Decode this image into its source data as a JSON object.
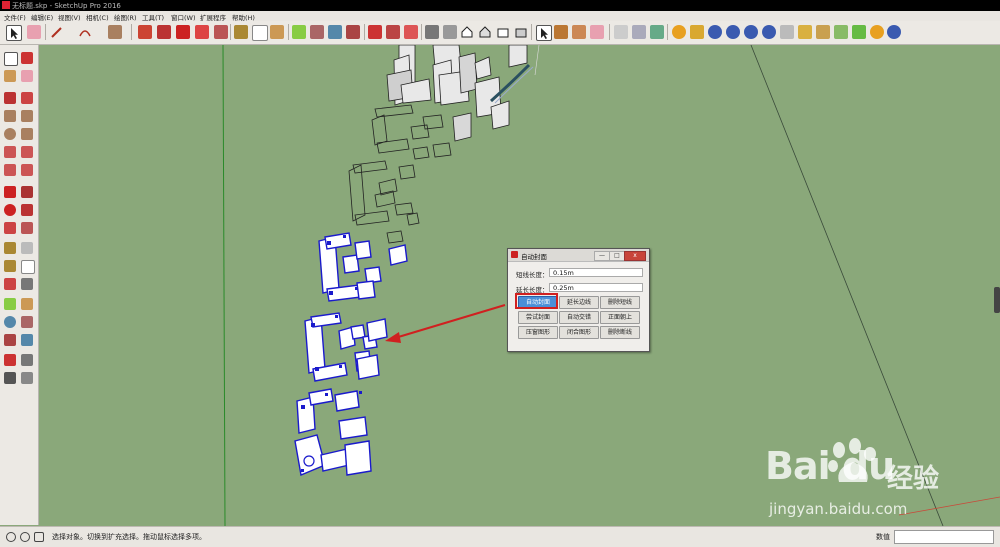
{
  "window": {
    "title": "无标题.skp - SketchUp Pro 2016"
  },
  "menu": {
    "items": [
      "文件(F)",
      "编辑(E)",
      "视图(V)",
      "相机(C)",
      "绘图(R)",
      "工具(T)",
      "窗口(W)",
      "扩展程序",
      "帮助(H)"
    ]
  },
  "dialog": {
    "title": "自动封面",
    "fields": [
      {
        "label": "短线长度：",
        "value": "0.15m"
      },
      {
        "label": "延长长度：",
        "value": "0.25m"
      }
    ],
    "buttons": [
      [
        "自动封面",
        "延长边线",
        "删除短线"
      ],
      [
        "尝试封面",
        "自动交错",
        "正面朝上"
      ],
      [
        "压窗图形",
        "闭合图形",
        "删除断线"
      ]
    ],
    "window_controls": [
      "—",
      "□",
      "x"
    ]
  },
  "status": {
    "message": "选择对象。切换到扩充选择。拖动鼠标选择多项。",
    "measurements_label": "数值",
    "measurements_value": ""
  },
  "watermark": {
    "logo_text": "Bai du",
    "logo_cn": "经验",
    "url": "jingyan.baidu.com"
  },
  "colors": {
    "canvas": "#8aa87a",
    "selection": "#1a1acc",
    "highlight": "#d02020",
    "active_button": "#4a8fd8"
  },
  "icons": {
    "toolbar": [
      "select-icon",
      "eraser-icon",
      "pencil-icon",
      "arc-icon",
      "rectangle-icon",
      "pushpull-icon",
      "move-icon",
      "rotate-icon",
      "scale-icon",
      "offset-icon",
      "tape-icon",
      "text-icon",
      "paint-icon",
      "orbit-icon",
      "pan-icon",
      "zoom-icon",
      "zoom-extents-icon",
      "warehouse-icon",
      "extension-icon",
      "camera-icon",
      "home-icon",
      "component-icon",
      "section-icon",
      "shaded-icon",
      "plugin-icon"
    ]
  }
}
